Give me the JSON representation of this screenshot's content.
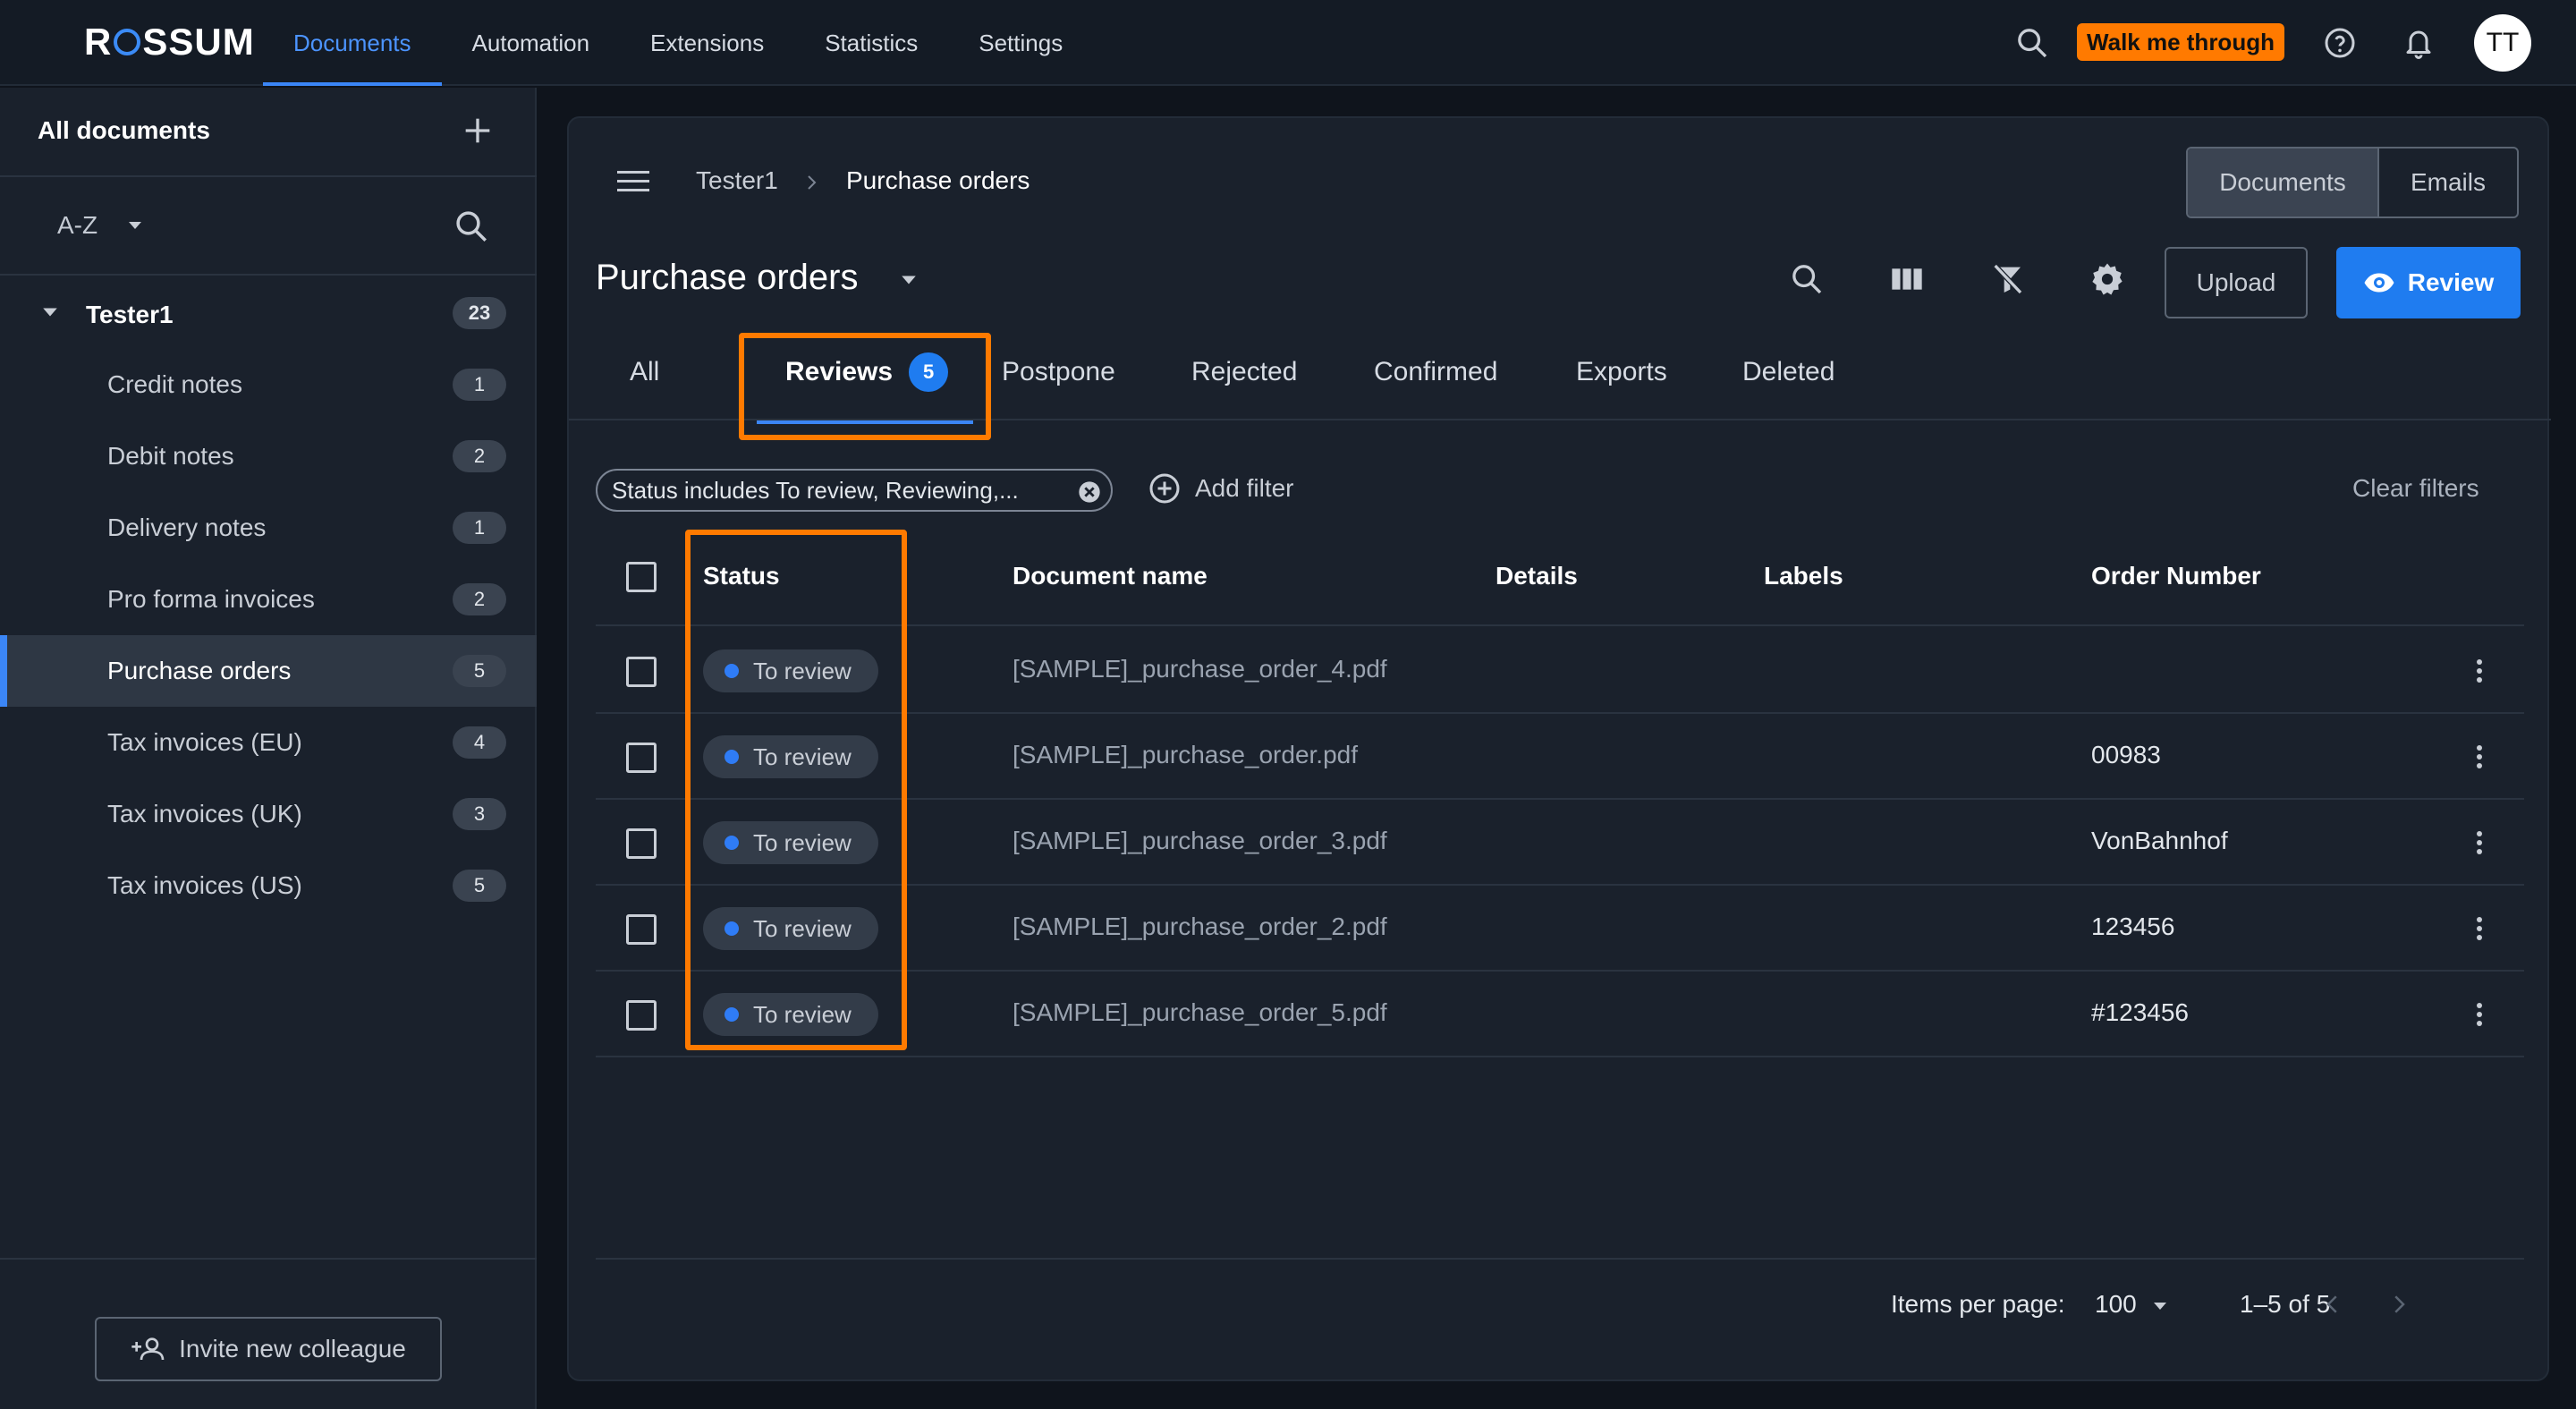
{
  "topbar": {
    "logo": "ROSSUM",
    "nav": [
      "Documents",
      "Automation",
      "Extensions",
      "Statistics",
      "Settings"
    ],
    "active_nav": "Documents",
    "walk_label": "Walk me through",
    "avatar_initials": "TT",
    "accent_color": "#3b86f7",
    "highlight_color": "#ff7a00"
  },
  "sidebar": {
    "title": "All documents",
    "sort_label": "A-Z",
    "root": {
      "label": "Tester1",
      "count": "23"
    },
    "items": [
      {
        "label": "Credit notes",
        "count": "1"
      },
      {
        "label": "Debit notes",
        "count": "2"
      },
      {
        "label": "Delivery notes",
        "count": "1"
      },
      {
        "label": "Pro forma invoices",
        "count": "2"
      },
      {
        "label": "Purchase orders",
        "count": "5",
        "active": true
      },
      {
        "label": "Tax invoices (EU)",
        "count": "4"
      },
      {
        "label": "Tax invoices (UK)",
        "count": "3"
      },
      {
        "label": "Tax invoices (US)",
        "count": "5"
      }
    ],
    "invite_label": "Invite new colleague"
  },
  "main": {
    "breadcrumb": [
      "Tester1",
      "Purchase orders"
    ],
    "view_toggle": [
      "Documents",
      "Emails"
    ],
    "title": "Purchase orders",
    "upload_label": "Upload",
    "review_label": "Review",
    "tabs": [
      {
        "label": "All"
      },
      {
        "label": "Reviews",
        "badge": "5",
        "active": true
      },
      {
        "label": "Postpone"
      },
      {
        "label": "Rejected"
      },
      {
        "label": "Confirmed"
      },
      {
        "label": "Exports"
      },
      {
        "label": "Deleted"
      }
    ],
    "filter_chip": "Status includes To review, Reviewing,...",
    "add_filter_label": "Add filter",
    "clear_filters_label": "Clear filters",
    "columns": [
      "Status",
      "Document name",
      "Details",
      "Labels",
      "Order Number"
    ],
    "rows": [
      {
        "status": "To review",
        "document": "[SAMPLE]_purchase_order_4.pdf",
        "order_number": ""
      },
      {
        "status": "To review",
        "document": "[SAMPLE]_purchase_order.pdf",
        "order_number": "00983"
      },
      {
        "status": "To review",
        "document": "[SAMPLE]_purchase_order_3.pdf",
        "order_number": "VonBahnhof"
      },
      {
        "status": "To review",
        "document": "[SAMPLE]_purchase_order_2.pdf",
        "order_number": "123456"
      },
      {
        "status": "To review",
        "document": "[SAMPLE]_purchase_order_5.pdf",
        "order_number": "#123456"
      }
    ],
    "pagination": {
      "items_per_page_label": "Items per page:",
      "items_per_page": "100",
      "range": "1–5 of 5"
    }
  }
}
